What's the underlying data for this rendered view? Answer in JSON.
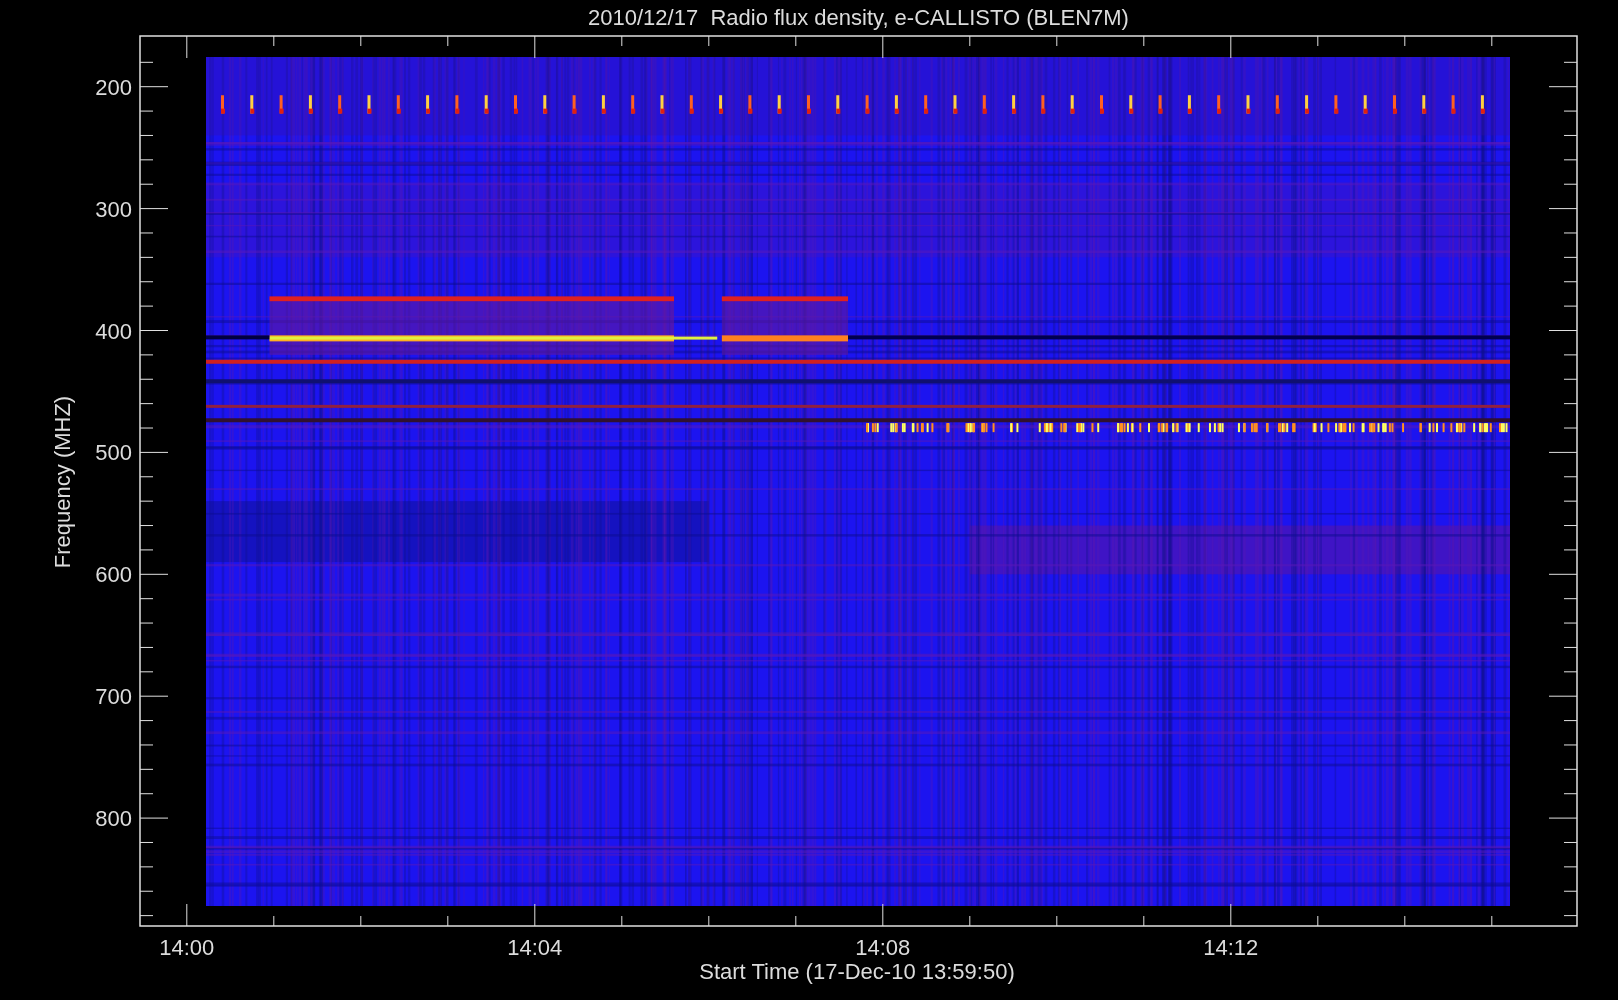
{
  "title": "2010/12/17  Radio flux density, e-CALLISTO (BLEN7M)",
  "xlabel": "Start Time (17-Dec-10 13:59:50)",
  "ylabel": "Frequency (MHZ)",
  "xticks": [
    "14:00",
    "14:04",
    "14:08",
    "14:12"
  ],
  "yticks": [
    "200",
    "300",
    "400",
    "500",
    "600",
    "700",
    "800"
  ]
}
